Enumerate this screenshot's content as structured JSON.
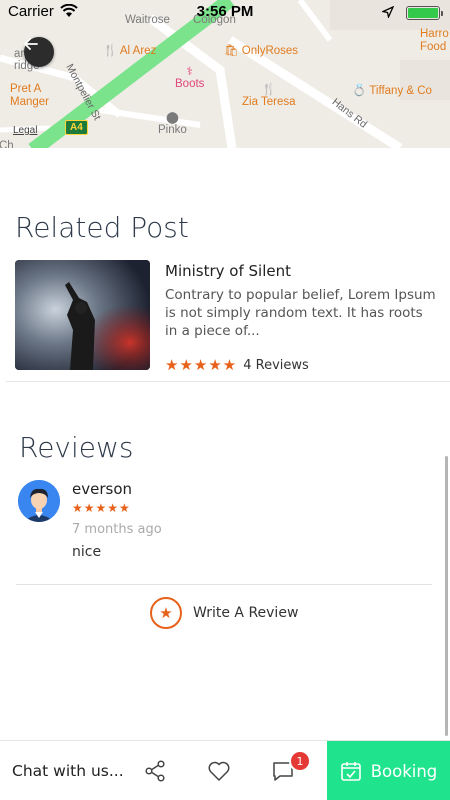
{
  "status_bar": {
    "carrier": "Carrier",
    "time": "3:56 PM"
  },
  "map": {
    "pois": {
      "al_arez": "Al Arez",
      "only_roses": "OnlyRoses",
      "boots": "Boots",
      "zia_teresa": "Zia Teresa",
      "tiffany": "Tiffany & Co",
      "pret_line1": "Pret A",
      "pret_line2": "Manger",
      "pinko": "Pinko",
      "harrods_line1": "Harro",
      "harrods_line2": "Food",
      "waitrose": "Waitrose",
      "cologon": "Cologon"
    },
    "roads": {
      "montpelier": "Montpelier St",
      "hans": "Hans Rd"
    },
    "partials": {
      "carpo_line1": "arpo",
      "carpo_line2": "ridge",
      "ch": "Ch"
    },
    "legal": "Legal",
    "road_badge": "A4"
  },
  "related": {
    "title": "Related Post",
    "post": {
      "title": "Ministry of Silent",
      "excerpt": "Contrary to popular belief, Lorem Ipsum is not simply random text. It has roots in a piece of...",
      "rating": 5,
      "stars": "★★★★★",
      "reviews": "4 Reviews"
    }
  },
  "reviews": {
    "title": "Reviews",
    "items": [
      {
        "name": "everson",
        "rating": 5,
        "stars": "★★★★★",
        "date": "7 months ago",
        "text": "nice"
      }
    ],
    "write_label": "Write A Review"
  },
  "bottom_bar": {
    "chat_label": "Chat with us...",
    "badge_count": "1",
    "booking_label": "Booking"
  },
  "colors": {
    "accent": "#e8611a",
    "booking": "#20e48d",
    "badge": "#e53935",
    "road_green": "#7be38c"
  },
  "icons": {
    "back": "arrow-left-icon",
    "share": "share-icon",
    "favorite": "heart-icon",
    "messages": "chat-bubble-icon",
    "booking": "calendar-check-icon",
    "write_review": "star-icon"
  }
}
